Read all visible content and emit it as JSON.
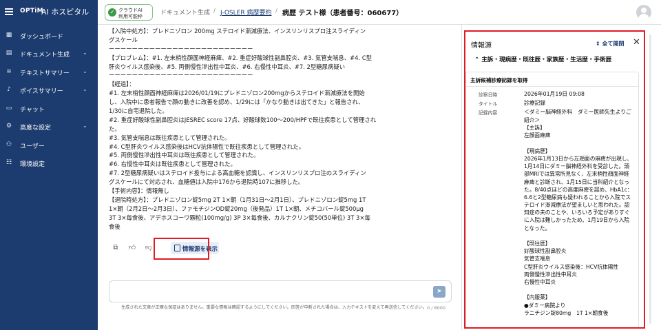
{
  "header": {
    "logo_brand": "OPTiM",
    "logo_app": "AI ホスピタル",
    "cloud_badge_line1": "クラウドAI",
    "cloud_badge_line2": "利用可能枠",
    "breadcrumb_1": "ドキュメント生成",
    "breadcrumb_sep": "/",
    "breadcrumb_2": "J-OSLER 病歴要約",
    "breadcrumb_3": "病歴 テスト様（患者番号：060677）"
  },
  "sidebar": {
    "items": [
      {
        "label": "ダッシュボード",
        "icon": "grid-icon",
        "expandable": false
      },
      {
        "label": "ドキュメント生成",
        "icon": "document-icon",
        "expandable": true
      },
      {
        "label": "テキストサマリー",
        "icon": "list-icon",
        "expandable": true
      },
      {
        "label": "ボイスサマリー",
        "icon": "voice-icon",
        "expandable": true
      },
      {
        "label": "チャット",
        "icon": "chat-icon",
        "expandable": false
      },
      {
        "label": "高度な設定",
        "icon": "gear-icon",
        "expandable": true
      },
      {
        "label": "ユーザー",
        "icon": "users-icon",
        "expandable": false
      },
      {
        "label": "環境設定",
        "icon": "settings-icon",
        "expandable": false
      }
    ]
  },
  "message": {
    "lines": [
      "【入院中処方】：プレドニゾロン 200mg ステロイド漸減療法、インスリンリスプロ注スライディン",
      "グスケール",
      "ーーーーーーーーーーーーーーーーーーーーーーーーー",
      "【プロブレム】：#1. 左末梢性顔面神経麻痺、#2. 重症好酸球性副鼻腔炎、#3. 気管支喘息、#4. C型",
      "肝炎ウイルス感染後、#5. 両側慢性滲出性中耳炎、#6. 右慢性中耳炎、#7. 2型糖尿病疑い",
      "ーーーーーーーーーーーーーーーーーーーーーーーーー",
      "【経過】：",
      "#1. 左末梢性顔面神経麻痺は2026/01/19にプレドニゾロン200mgからステロイド漸減療法を開始",
      "し、入院中に患者報告で顔の動きに改善を認め、1/29には「かなり動きは出てきた」と報告され、",
      "1/30に自宅退院した。",
      "#2. 重症好酸球性副鼻腔炎はJESREC score 17点、好酸球数100～200/HPFで既往疾患として管理され",
      "た。",
      "#3. 気管支喘息は既往疾患として管理された。",
      "#4. C型肝炎ウイルス感染後はHCV抗体陽性で既往疾患として管理された。",
      "#5. 両側慢性滲出性中耳炎は既往疾患として管理された。",
      "#6. 右慢性中耳炎は既往疾患として管理された。",
      "#7. 2型糖尿病疑いはステロイド投与による高血糖を認識し、インスリンリスプロ注のスライディン",
      "グスケールにて対応され、血糖値は入院中176から退院時107に推移した。",
      "【手術内容】：情報無し",
      "【退院時処方】：プレドニゾロン錠5mg 2T 1×朝（1月31日～2月1日）、プレドニゾロン錠5mg 1T",
      "1×朝（2月2日～2月3日）、ファモチジンOD錠20mg（後発品）1T 1×朝、メチコバール錠500μg",
      "3T 3×毎食後、アデホスコーワ顆粒(100mg/g) 3P 3×毎食後、カルナクリン錠50(50単位) 3T 3×毎",
      "食後"
    ],
    "show_source_label": "情報源を表示"
  },
  "composer": {
    "placeholder": "",
    "counter": "0 / 8000",
    "disclaimer": "生成された文章が正確な保証はありません。重要な情報は確認するようにしてください。回答が中断された場合は、入力テキストを変えて再送信してください。"
  },
  "source_panel": {
    "title": "情報源",
    "expand_all": "全て開閉",
    "section_title": "主訴・現病歴・既往歴・家族歴・生活歴・手術歴",
    "card_title": "主訴候補診療記録を取得",
    "fields": [
      {
        "label": "診察日時",
        "value": "2026年01月19日 09:08"
      },
      {
        "label": "タイトル",
        "value": "診療記録"
      },
      {
        "label": "記録内容",
        "value": "＜ダミー脳神経外科　ダミー医師先生よりご"
      }
    ],
    "content_lines": [
      "紹介＞",
      "【主訴】",
      "左顔面麻痺",
      "",
      "【現病歴】",
      "2026年1月13日から左顔面の麻痺が出現し、",
      "1月14日にダミー脳神経外科を受診した。頭",
      "部MRIでは異常所見なく、左末梢性顔面神経",
      "麻痺と診断され、1月15日に当科紹介となっ",
      "た。8/40点ほどの高度麻痺を認め、HbA1c：",
      "6.6と2型糖尿病も疑われることから入院でス",
      "テロイド漸減療法が望ましいと思われた。認",
      "知症の夫のことや、いろいろ予定がありすぐ",
      "に入院は難しかったため、1月19日から入院",
      "となった。",
      "",
      "【既往歴】",
      "好酸球性副鼻腔炎",
      "気管支喘息",
      "C型肝炎ウイルス感染後：HCV抗体陽性",
      "両側慢性滲出性中耳炎",
      "右慢性中耳炎",
      "",
      "【内服薬】",
      "●ダミー病院より",
      "ラニチジン錠80mg　1T 1×朝食後"
    ]
  }
}
